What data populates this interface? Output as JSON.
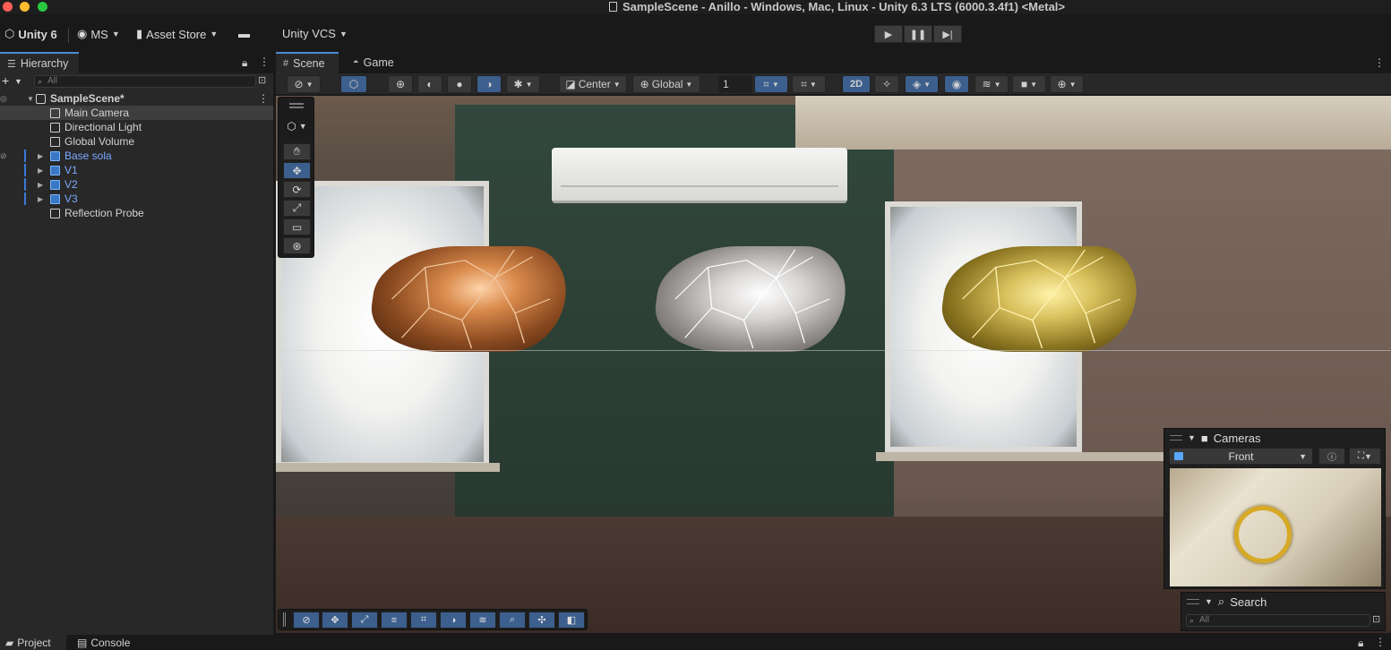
{
  "window": {
    "title": "SampleScene - Anillo - Windows, Mac, Linux - Unity 6.3 LTS (6000.3.4f1) <Metal>"
  },
  "toolbar": {
    "unity_label": "Unity 6",
    "account_label": "MS",
    "asset_store_label": "Asset Store",
    "vcs_label": "Unity VCS"
  },
  "hierarchy": {
    "tab_label": "Hierarchy",
    "search_placeholder": "All",
    "scene_name": "SampleScene*",
    "items": [
      {
        "label": "Main Camera",
        "selected": true,
        "prefab": false
      },
      {
        "label": "Directional Light",
        "prefab": false
      },
      {
        "label": "Global Volume",
        "prefab": false
      },
      {
        "label": "Base sola",
        "prefab": true
      },
      {
        "label": "V1",
        "prefab": true
      },
      {
        "label": "V2",
        "prefab": true
      },
      {
        "label": "V3",
        "prefab": true
      },
      {
        "label": "Reflection Probe",
        "prefab": false
      }
    ]
  },
  "scene_tabs": {
    "scene_label": "Scene",
    "game_label": "Game"
  },
  "scene_toolbar": {
    "pivot_label": "Center",
    "space_label": "Global",
    "grid_value": "1",
    "mode_2d_label": "2D"
  },
  "cameras_overlay": {
    "title": "Cameras",
    "selected_camera": "Front"
  },
  "search_overlay": {
    "title": "Search",
    "placeholder": "All"
  },
  "bottom_tabs": {
    "project_label": "Project",
    "console_label": "Console"
  },
  "colors": {
    "accent": "#4d8bd6",
    "toggle_on": "#3c5f8d",
    "prefab_text": "#7aa8ff"
  }
}
